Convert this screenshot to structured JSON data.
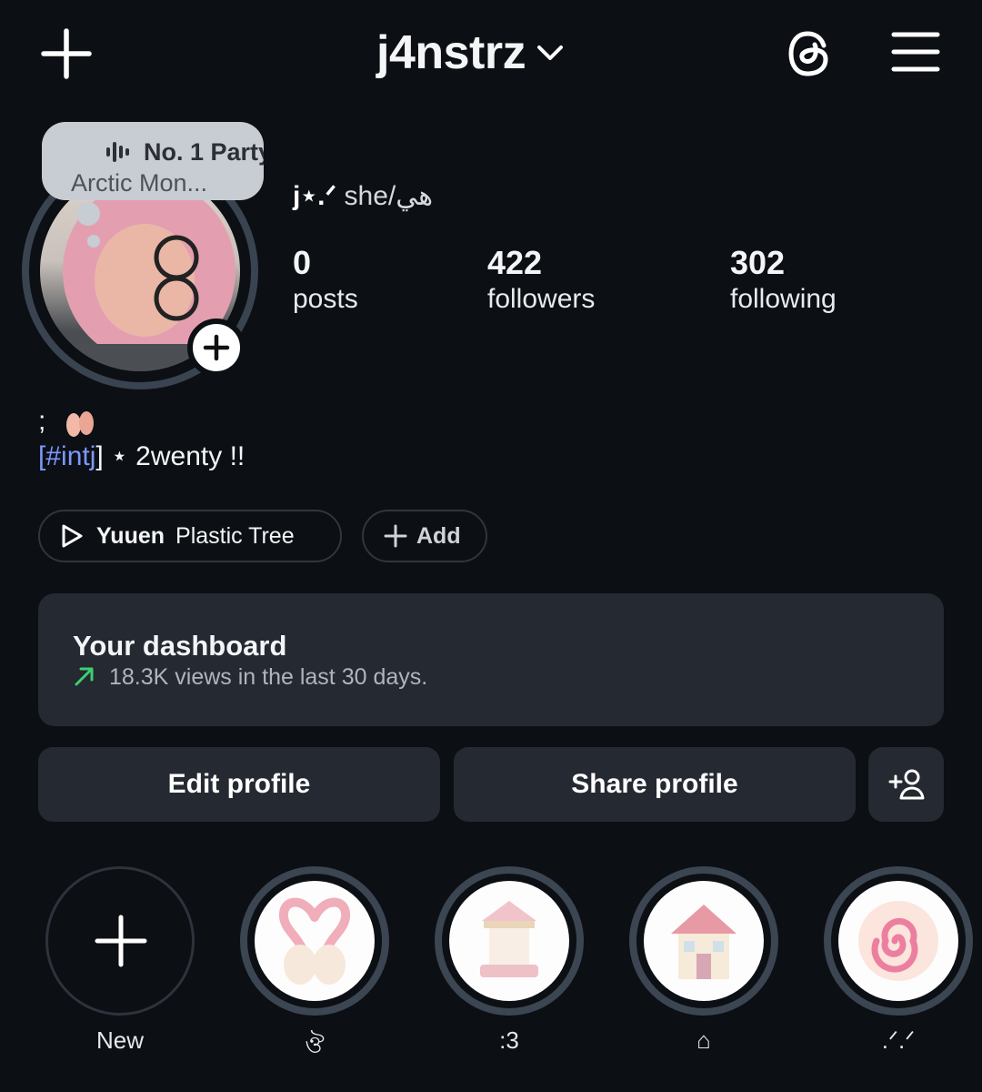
{
  "header": {
    "username": "j4nstrz"
  },
  "note": {
    "song_title": "No. 1 Party",
    "artist": "Arctic Mon..."
  },
  "profile": {
    "display_name": "j⋆.ᐟ",
    "pronouns": "she/هي"
  },
  "stats": {
    "posts": {
      "value": "0",
      "label": "posts"
    },
    "followers": {
      "value": "422",
      "label": "followers"
    },
    "following": {
      "value": "302",
      "label": "following"
    }
  },
  "bio": {
    "line1": ";",
    "line2_open": "[",
    "hashtag": "#intj",
    "line2_rest": "] ⋆ 2wenty !!"
  },
  "music": {
    "song": "Yuuen",
    "artist": "Plastic Tree",
    "add_label": "Add"
  },
  "dashboard": {
    "title": "Your dashboard",
    "subtitle": "18.3K views in the last 30 days.",
    "accent": "#3ccf6e"
  },
  "buttons": {
    "edit": "Edit profile",
    "share": "Share profile"
  },
  "highlights": [
    {
      "label": "New"
    },
    {
      "label": "ঔ"
    },
    {
      "label": ":3"
    },
    {
      "label": "⌂"
    },
    {
      "label": ".ᐟ.ᐟ"
    }
  ]
}
